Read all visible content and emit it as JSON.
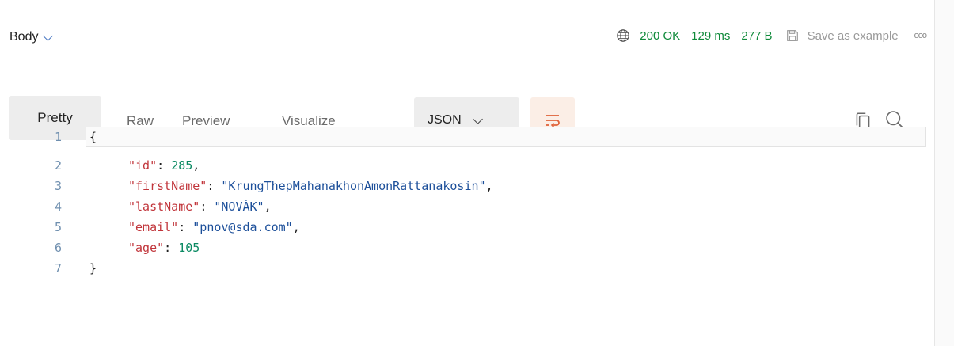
{
  "header": {
    "body_label": "Body",
    "status": "200 OK",
    "time": "129 ms",
    "size": "277 B",
    "save_label": "Save as example",
    "more_label": "ooo"
  },
  "tabs": [
    {
      "label": "Pretty",
      "active": true
    },
    {
      "label": "Raw",
      "active": false
    },
    {
      "label": "Preview",
      "active": false
    },
    {
      "label": "Visualize",
      "active": false
    }
  ],
  "format_select": {
    "value": "JSON"
  },
  "icons": [
    "globe-icon",
    "save-icon",
    "wrap-lines-icon",
    "copy-icon",
    "search-icon",
    "chevron-down-icon"
  ],
  "colors": {
    "status_green": "#0f8a3a",
    "json_key": "#c1353b",
    "json_string": "#1c4f9a",
    "json_number": "#0b8a63",
    "wrap_accent": "#e0633a"
  },
  "code": {
    "lines": [
      {
        "n": "1",
        "text": "{"
      },
      {
        "n": "2",
        "key": "\"id\"",
        "value": "285",
        "type": "number",
        "comma": ","
      },
      {
        "n": "3",
        "key": "\"firstName\"",
        "value": "\"KrungThepMahanakhonAmonRattanakosin\"",
        "type": "string",
        "comma": ","
      },
      {
        "n": "4",
        "key": "\"lastName\"",
        "value": "\"NOVÁK\"",
        "type": "string",
        "comma": ","
      },
      {
        "n": "5",
        "key": "\"email\"",
        "value": "\"pnov@sda.com\"",
        "type": "string",
        "comma": ","
      },
      {
        "n": "6",
        "key": "\"age\"",
        "value": "105",
        "type": "number",
        "comma": ""
      },
      {
        "n": "7",
        "text": "}"
      }
    ]
  }
}
